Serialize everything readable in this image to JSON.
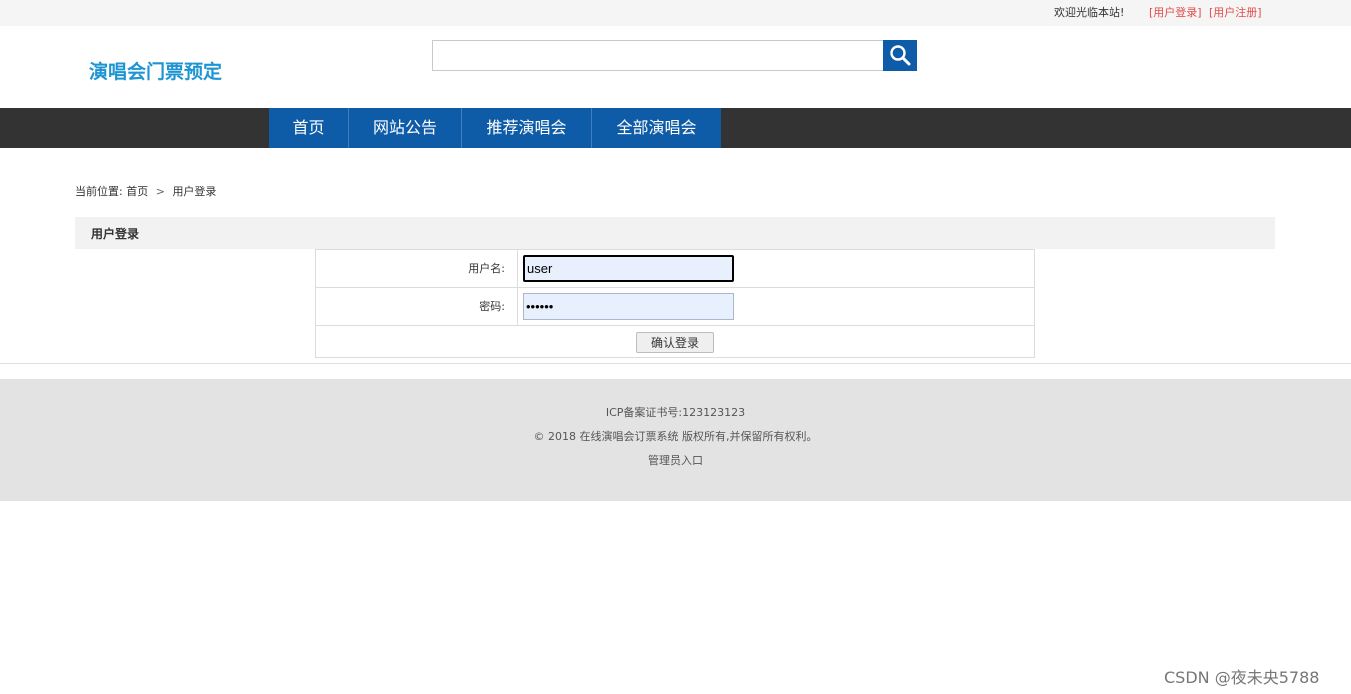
{
  "topbar": {
    "welcome": "欢迎光临本站!",
    "login_link": "[用户登录]",
    "register_link": "[用户注册]"
  },
  "header": {
    "logo": "演唱会门票预定",
    "search": {
      "value": "",
      "placeholder": "",
      "icon": "search-icon"
    }
  },
  "nav": {
    "items": [
      "首页",
      "网站公告",
      "推荐演唱会",
      "全部演唱会"
    ]
  },
  "breadcrumb": {
    "prefix": "当前位置:",
    "home": "首页",
    "separator": ">",
    "current": "用户登录"
  },
  "login_form": {
    "title": "用户登录",
    "username_label": "用户名:",
    "username_value": "user",
    "password_label": "密码:",
    "password_value": "123456",
    "submit_label": "确认登录"
  },
  "footer": {
    "icp": "ICP备案证书号:123123123",
    "copyright": "© 2018 在线演唱会订票系统 版权所有,并保留所有权利。",
    "admin_link": "管理员入口"
  },
  "watermark": "CSDN @夜未央5788",
  "colors": {
    "brand_blue": "#0e5ba7",
    "logo_blue": "#1e95d2",
    "nav_bg": "#333333",
    "link_red": "#e34c4c",
    "footer_bg": "#e3e3e3"
  }
}
